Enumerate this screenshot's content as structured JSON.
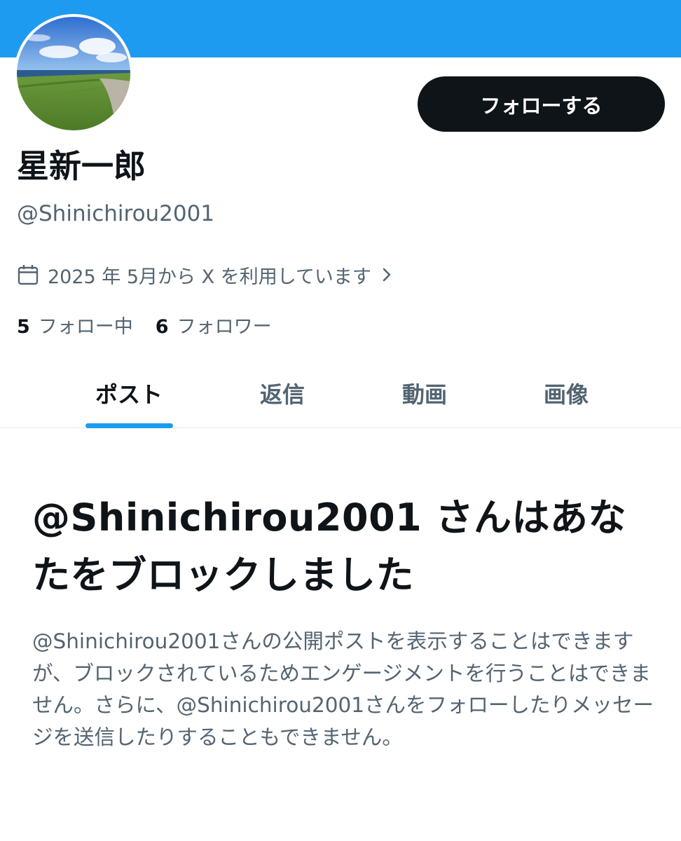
{
  "colors": {
    "banner": "#1d9bf0",
    "accent": "#1d9bf0",
    "follow_button_bg": "#0f1419",
    "text_primary": "#0f1419",
    "text_secondary": "#536471"
  },
  "profile": {
    "display_name": "星新一郎",
    "handle": "@Shinichirou2001",
    "joined": "2025 年 5月から X を利用しています",
    "joined_icon": "calendar-icon",
    "avatar_icon": "avatar-landscape"
  },
  "actions": {
    "follow_label": "フォローする"
  },
  "stats": {
    "following_count": "5",
    "following_label": "フォロー中",
    "followers_count": "6",
    "followers_label": "フォロワー"
  },
  "tabs": [
    {
      "label": "ポスト",
      "active": true
    },
    {
      "label": "返信",
      "active": false
    },
    {
      "label": "動画",
      "active": false
    },
    {
      "label": "画像",
      "active": false
    }
  ],
  "blocked": {
    "title": "@Shinichirou2001 さんはあなたをブロックしました",
    "body": "@Shinichirou2001さんの公開ポストを表示することはできますが、ブロックされているためエンゲージメントを行うことはできません。さらに、@Shinichirou2001さんをフォローしたりメッセージを送信したりすることもできません。"
  }
}
